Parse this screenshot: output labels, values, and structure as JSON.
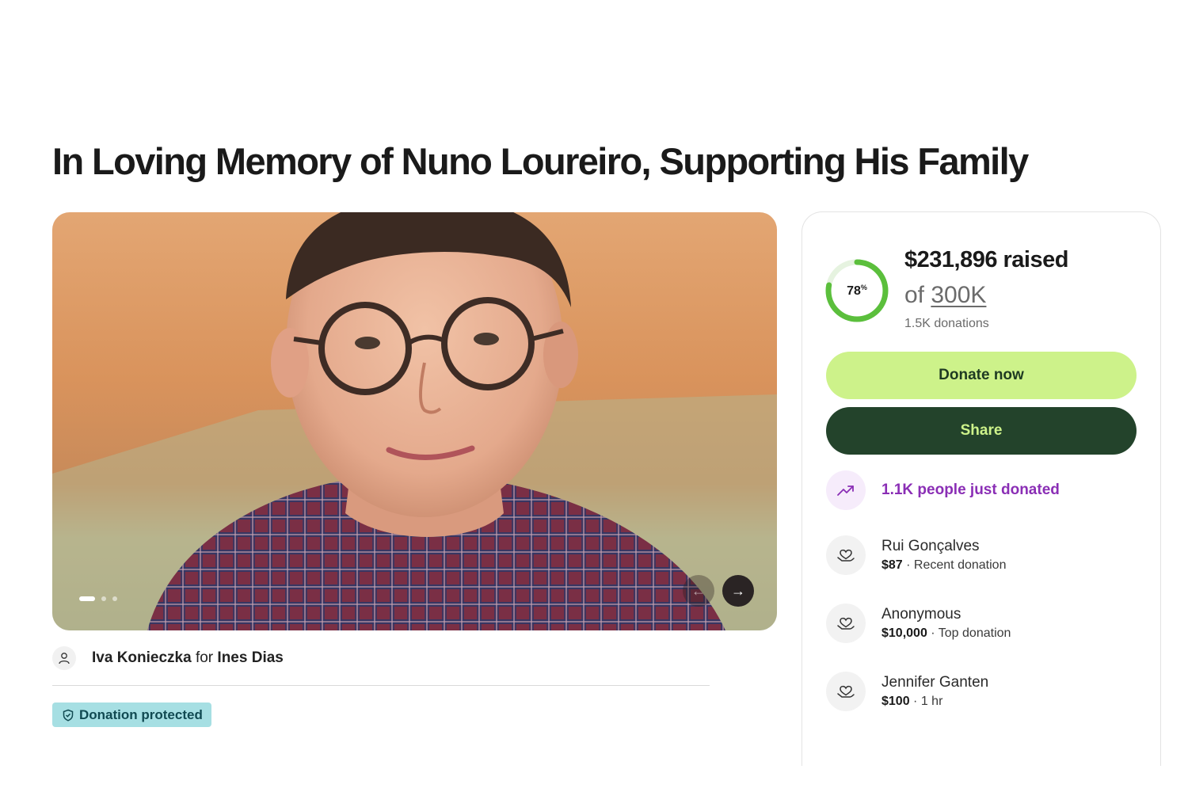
{
  "campaign": {
    "title": "In Loving Memory of Nuno Loureiro, Supporting His Family"
  },
  "hero": {
    "image": "portrait-photo",
    "slides": 3,
    "active_slide": 1
  },
  "organizer": {
    "name": "Iva Konieczka",
    "connector": "for",
    "beneficiary": "Ines Dias",
    "icon": "user-icon"
  },
  "badge": {
    "label": "Donation protected",
    "icon": "shield-icon"
  },
  "progress": {
    "percent": 78,
    "percent_label": "78",
    "percent_sign": "%",
    "raised": "$231,896 raised",
    "goal_prefix": "of",
    "goal": "300K",
    "donations": "1.5K donations",
    "ring_color": "#5bbf3c"
  },
  "actions": {
    "donate_label": "Donate now",
    "share_label": "Share"
  },
  "activity": {
    "text": "1.1K people just donated",
    "icon": "trending-up-icon",
    "color": "#8a2eb5"
  },
  "donors": [
    {
      "name": "Rui Gonçalves",
      "amount": "$87",
      "note": "· Recent donation"
    },
    {
      "name": "Anonymous",
      "amount": "$10,000",
      "note": "· Top donation"
    },
    {
      "name": "Jennifer Ganten",
      "amount": "$100",
      "note": "· 1 hr"
    }
  ]
}
